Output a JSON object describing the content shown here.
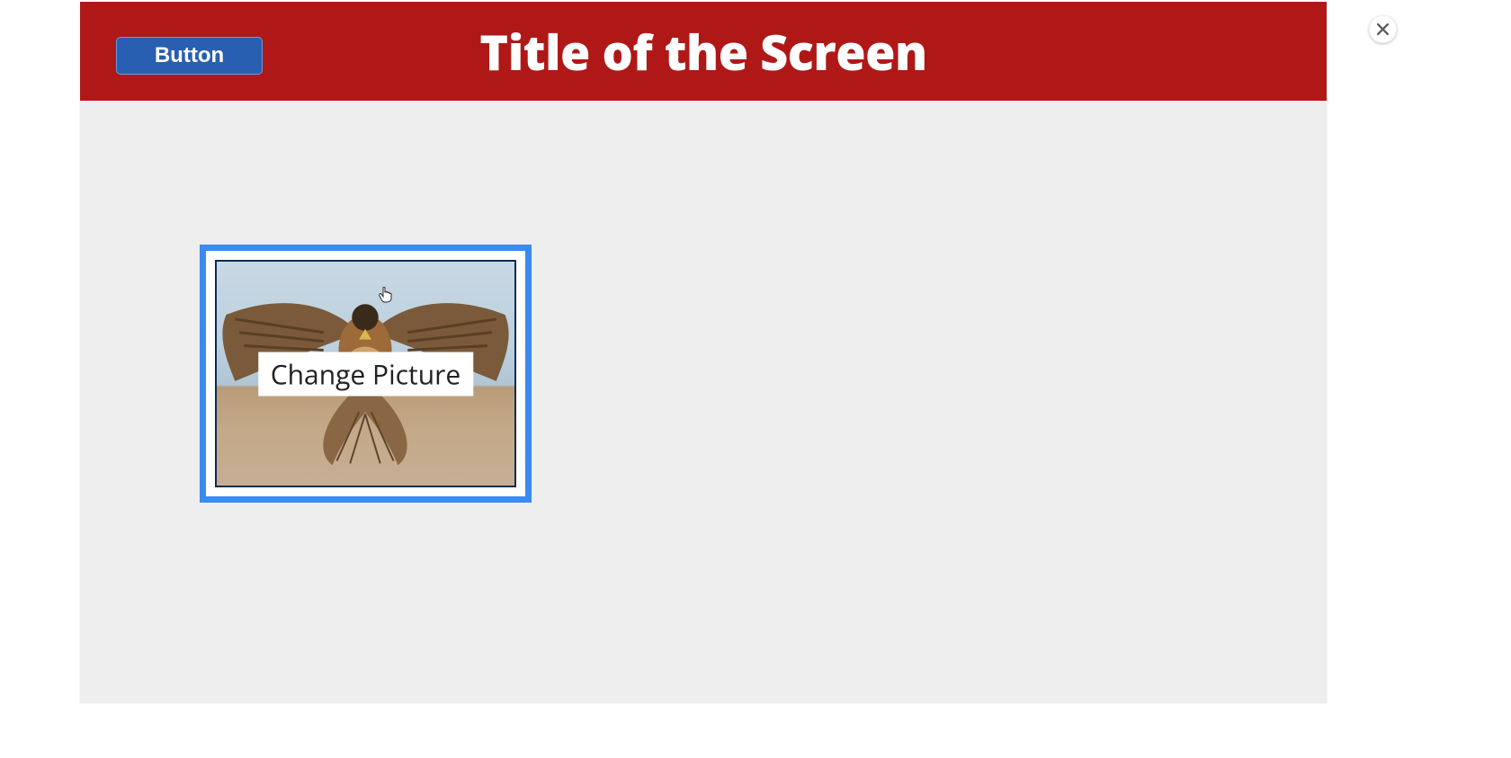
{
  "header": {
    "button_label": "Button",
    "title": "Title of the Screen"
  },
  "image_card": {
    "overlay_label": "Change Picture"
  }
}
